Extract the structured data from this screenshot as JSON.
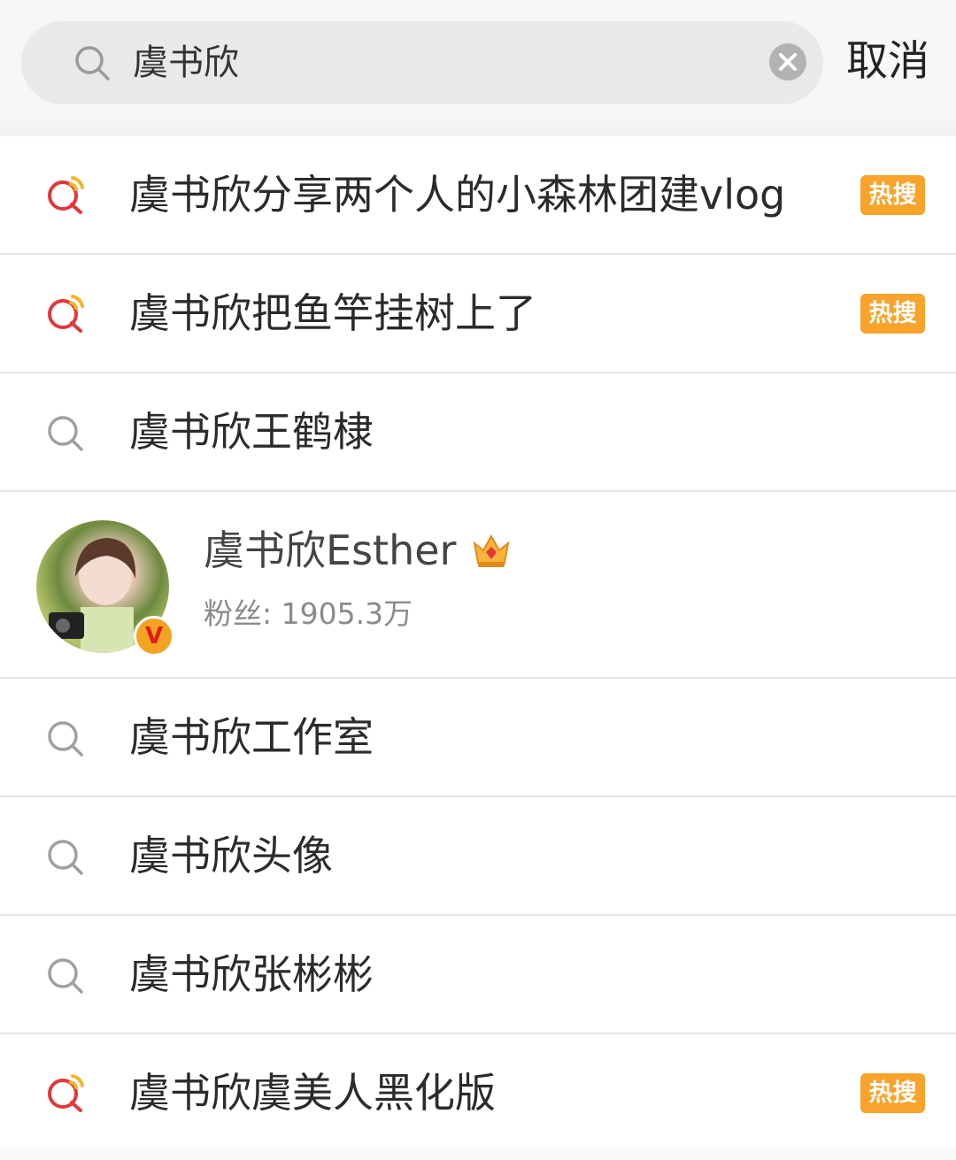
{
  "search": {
    "query": "虞书欣",
    "cancel_label": "取消"
  },
  "results": [
    {
      "text": "虞书欣分享两个人的小森林团建vlog",
      "icon": "hot-search-icon",
      "badge": "热搜"
    },
    {
      "text": "虞书欣把鱼竿挂树上了",
      "icon": "hot-search-icon",
      "badge": "热搜"
    },
    {
      "text": "虞书欣王鹤棣",
      "icon": "search-icon",
      "badge": ""
    }
  ],
  "user": {
    "name": "虞书欣Esther",
    "fans": "粉丝: 1905.3万"
  },
  "results2": [
    {
      "text": "虞书欣工作室",
      "icon": "search-icon",
      "badge": ""
    },
    {
      "text": "虞书欣头像",
      "icon": "search-icon",
      "badge": ""
    },
    {
      "text": "虞书欣张彬彬",
      "icon": "search-icon",
      "badge": ""
    },
    {
      "text": "虞书欣虞美人黑化版",
      "icon": "hot-search-icon",
      "badge": "热搜"
    }
  ],
  "colors": {
    "badge": "#f7a32c",
    "hot_icon_red": "#e2383a",
    "hot_icon_yellow": "#f5b52a"
  }
}
